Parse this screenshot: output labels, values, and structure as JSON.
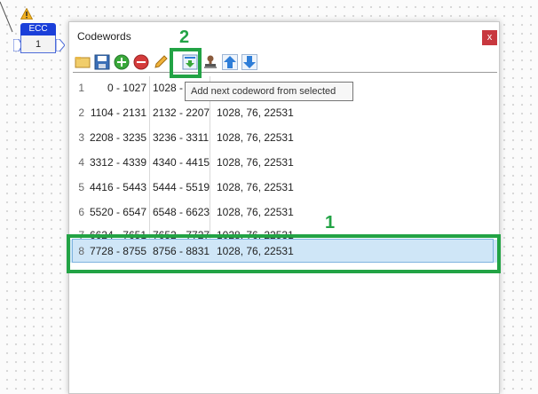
{
  "node": {
    "label": "ECC",
    "value": "1"
  },
  "dialog": {
    "title": "Codewords",
    "close_label": "x"
  },
  "toolbar": {
    "buttons": [
      {
        "name": "open-folder-icon",
        "color": "#e8b84a"
      },
      {
        "name": "save-icon",
        "color": "#3b6fb6"
      },
      {
        "name": "add-icon",
        "color": "#3aa83a"
      },
      {
        "name": "remove-icon",
        "color": "#d43b3b"
      },
      {
        "name": "edit-icon",
        "color": "#e09a28"
      },
      {
        "name": "add-next-codeword-icon",
        "color": "#2f7ed8"
      },
      {
        "name": "stamp-icon",
        "color": "#8a5a3b"
      },
      {
        "name": "move-up-icon",
        "color": "#2f7ed8"
      },
      {
        "name": "move-down-icon",
        "color": "#2f7ed8"
      }
    ]
  },
  "tooltip": "Add next codeword from selected",
  "rows": [
    {
      "num": "1",
      "range": "0 - 1027",
      "sub": "1028 -",
      "params": ""
    },
    {
      "num": "2",
      "range": "1104 - 2131",
      "sub": "2132 - 2207",
      "params": "1028, 76, 22531"
    },
    {
      "num": "3",
      "range": "2208 - 3235",
      "sub": "3236 - 3311",
      "params": "1028, 76, 22531"
    },
    {
      "num": "4",
      "range": "3312 - 4339",
      "sub": "4340 - 4415",
      "params": "1028, 76, 22531"
    },
    {
      "num": "5",
      "range": "4416 - 5443",
      "sub": "5444 - 5519",
      "params": "1028, 76, 22531"
    },
    {
      "num": "6",
      "range": "5520 - 6547",
      "sub": "6548 - 6623",
      "params": "1028, 76, 22531"
    },
    {
      "num": "7",
      "range": "6624 - 7651",
      "sub": "7652 - 7727",
      "params": "1028, 76, 22531"
    },
    {
      "num": "8",
      "range": "7728 - 8755",
      "sub": "8756 - 8831",
      "params": "1028, 76, 22531"
    }
  ],
  "annotations": {
    "one": "1",
    "two": "2"
  },
  "colors": {
    "annotation": "#22a345",
    "selection": "#cfe6f7",
    "node": "#1a3fd9"
  }
}
